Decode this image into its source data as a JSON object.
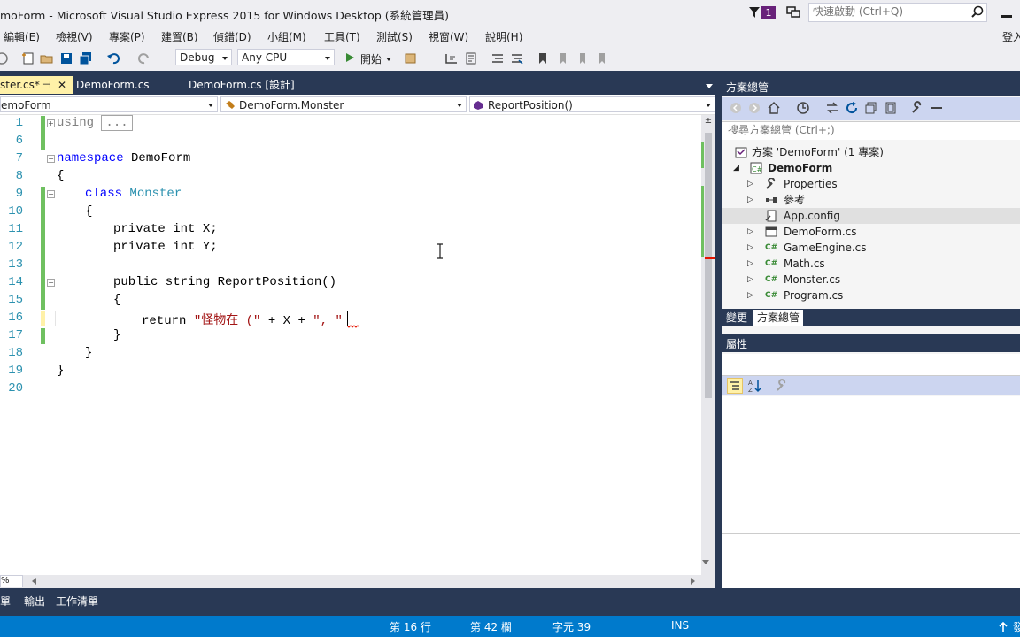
{
  "window": {
    "title": "moForm - Microsoft Visual Studio Express 2015 for Windows Desktop (系統管理員)",
    "notification_count": "1",
    "quick_launch_placeholder": "快速啟動 (Ctrl+Q)",
    "sign_in": "登入"
  },
  "menu": [
    "編輯(E)",
    "檢視(V)",
    "專案(P)",
    "建置(B)",
    "偵錯(D)",
    "小組(M)",
    "工具(T)",
    "測試(S)",
    "視窗(W)",
    "說明(H)"
  ],
  "toolbar": {
    "config": "Debug",
    "platform": "Any CPU",
    "start_label": "開始"
  },
  "tabs": [
    {
      "label": "ster.cs*",
      "active": true
    },
    {
      "label": "DemoForm.cs",
      "active": false
    },
    {
      "label": "DemoForm.cs [設計]",
      "active": false
    }
  ],
  "navbar": {
    "project": "emoForm",
    "class": "DemoForm.Monster",
    "member": "ReportPosition()"
  },
  "code": {
    "line_numbers": [
      "1",
      "6",
      "7",
      "8",
      "9",
      "10",
      "11",
      "12",
      "13",
      "14",
      "15",
      "16",
      "17",
      "18",
      "19",
      "20"
    ],
    "using_keyword": "using",
    "using_collapsed": "...",
    "namespace_keyword": "namespace",
    "namespace_name": "DemoForm",
    "open_brace": "{",
    "close_brace": "}",
    "class_keyword": "class",
    "class_name": "Monster",
    "field_x": "private int X;",
    "field_y": "private int Y;",
    "method_sig": "public string ReportPosition()",
    "return_keyword": "return",
    "return_str1": "\"怪物在 (\"",
    "return_plus_x": " + X + ",
    "return_str2": "\", \"",
    "return_trailing": " "
  },
  "solution_explorer": {
    "title": "方案總管",
    "search_placeholder": "搜尋方案總管 (Ctrl+;)",
    "solution": "方案 'DemoForm' (1 專案)",
    "project": "DemoForm",
    "items": [
      "Properties",
      "參考",
      "App.config",
      "DemoForm.cs",
      "GameEngine.cs",
      "Math.cs",
      "Monster.cs",
      "Program.cs"
    ],
    "selected": "App.config"
  },
  "panel_tabs": [
    "變更",
    "方案總管"
  ],
  "properties": {
    "title": "屬性"
  },
  "bottom_tabs": [
    "清單",
    "輸出",
    "工作清單"
  ],
  "zoom": "%",
  "status": {
    "line": "第 16 行",
    "col": "第 42 欄",
    "ch": "字元 39",
    "mode": "INS",
    "publish": "發"
  },
  "colors": {
    "accent": "#007acc",
    "chrome": "#eeeef2",
    "dark": "#293955",
    "active_tab": "#fff1a8",
    "keyword": "#0000ff",
    "type": "#2b91af",
    "string": "#a31515"
  }
}
